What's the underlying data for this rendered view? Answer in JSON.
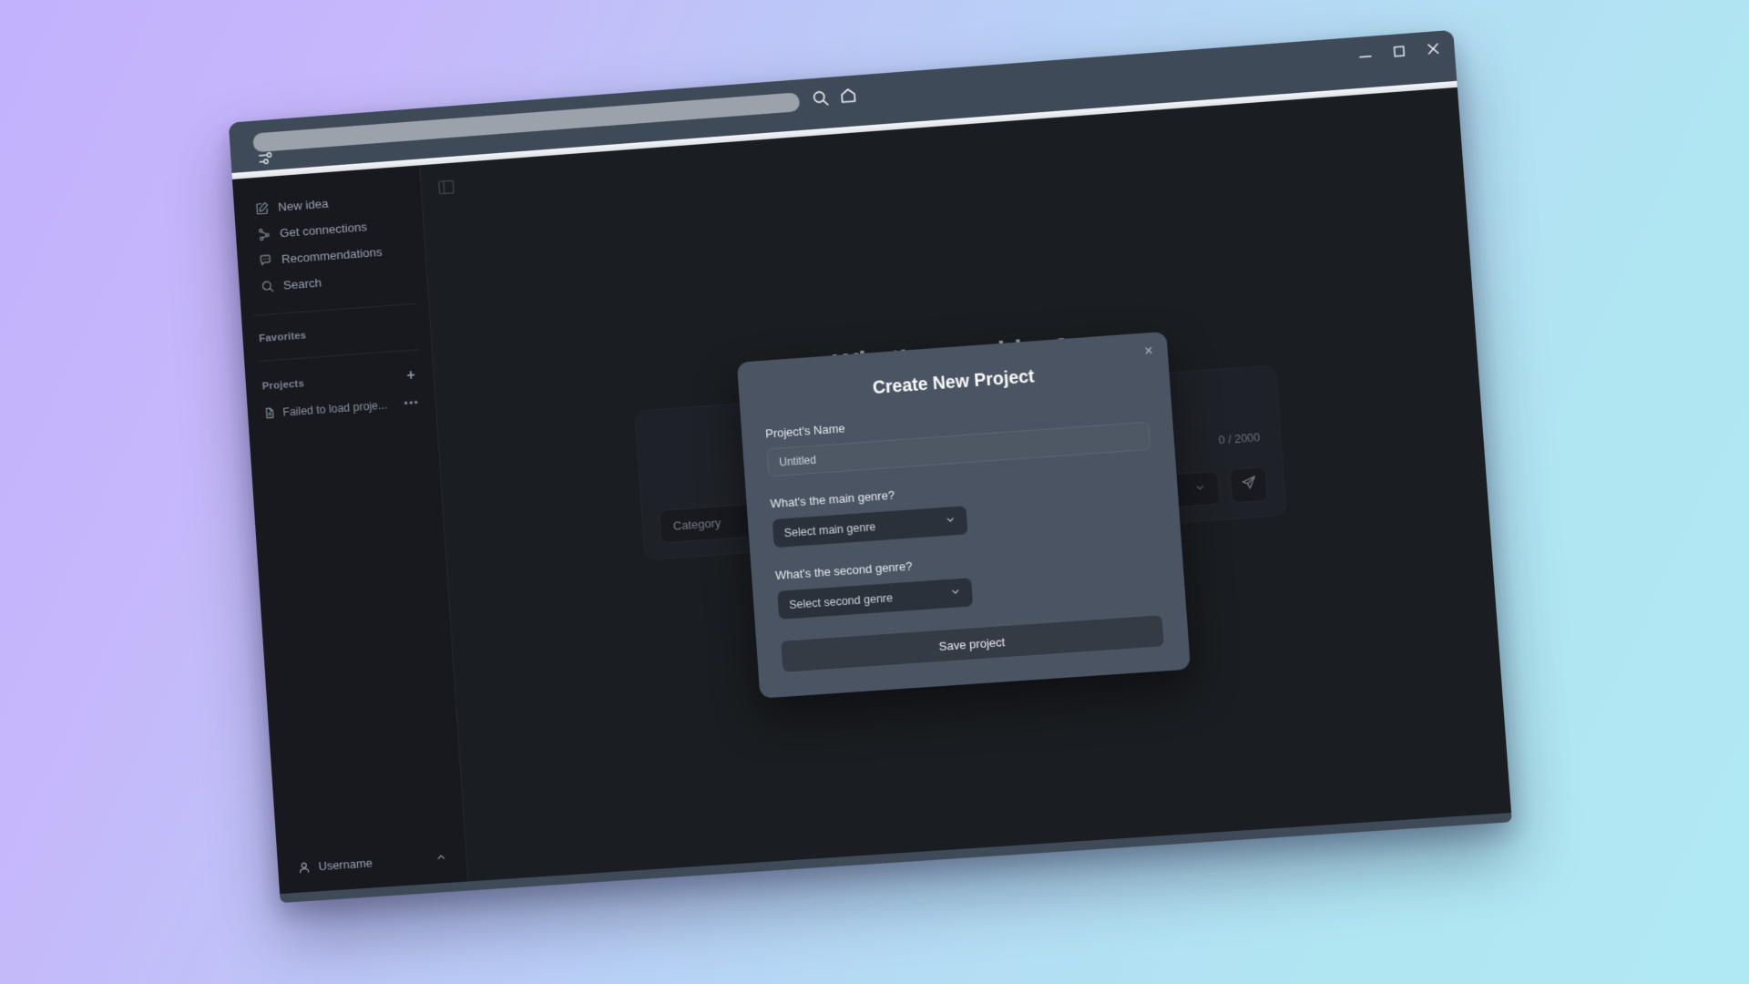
{
  "browser_chrome": {
    "url_value": "",
    "url_placeholder": "",
    "sliders_icon": "sliders-icon",
    "search_icon": "search-icon",
    "home_icon": "home-icon",
    "minimize_label": "Minimize",
    "maximize_label": "Maximize",
    "close_label": "Close"
  },
  "sidebar": {
    "nav_items": [
      {
        "label": "New idea",
        "icon": "pencil-square-icon"
      },
      {
        "label": "Get connections",
        "icon": "network-icon"
      },
      {
        "label": "Recommendations",
        "icon": "message-dots-icon"
      },
      {
        "label": "Search",
        "icon": "search-icon"
      }
    ],
    "favorites_label": "Favorites",
    "projects_label": "Projects",
    "projects_add_label": "+",
    "project_items": [
      {
        "label": "Failed to load proje...",
        "icon": "document-icon",
        "more_label": "•••"
      }
    ],
    "user": {
      "label": "Username",
      "icon": "user-icon",
      "chevron": "chevron-up-icon"
    }
  },
  "main": {
    "panel_toggle_icon": "sidebar-toggle-icon",
    "hero_title": "What's your idea?",
    "composer": {
      "counter": "0 / 2000",
      "category_label": "Category",
      "category_chevron": "chevron-down-icon",
      "send_icon": "send-icon"
    }
  },
  "modal": {
    "title": "Create New Project",
    "close_label": "×",
    "name_label": "Project's Name",
    "name_value": "Untitled",
    "name_placeholder": "Untitled",
    "main_genre_label": "What's the main genre?",
    "main_genre_value": "Select main genre",
    "second_genre_label": "What's the second genre?",
    "second_genre_value": "Select second genre",
    "chevron_icon": "chevron-down-icon",
    "save_label": "Save project"
  },
  "colors": {
    "bg_gradient_start": "#c2b1fd",
    "bg_gradient_end": "#b0e6f2",
    "chrome": "#3f4a58",
    "sidebar": "#17191e",
    "main": "#212429",
    "modal": "#4a5462"
  }
}
